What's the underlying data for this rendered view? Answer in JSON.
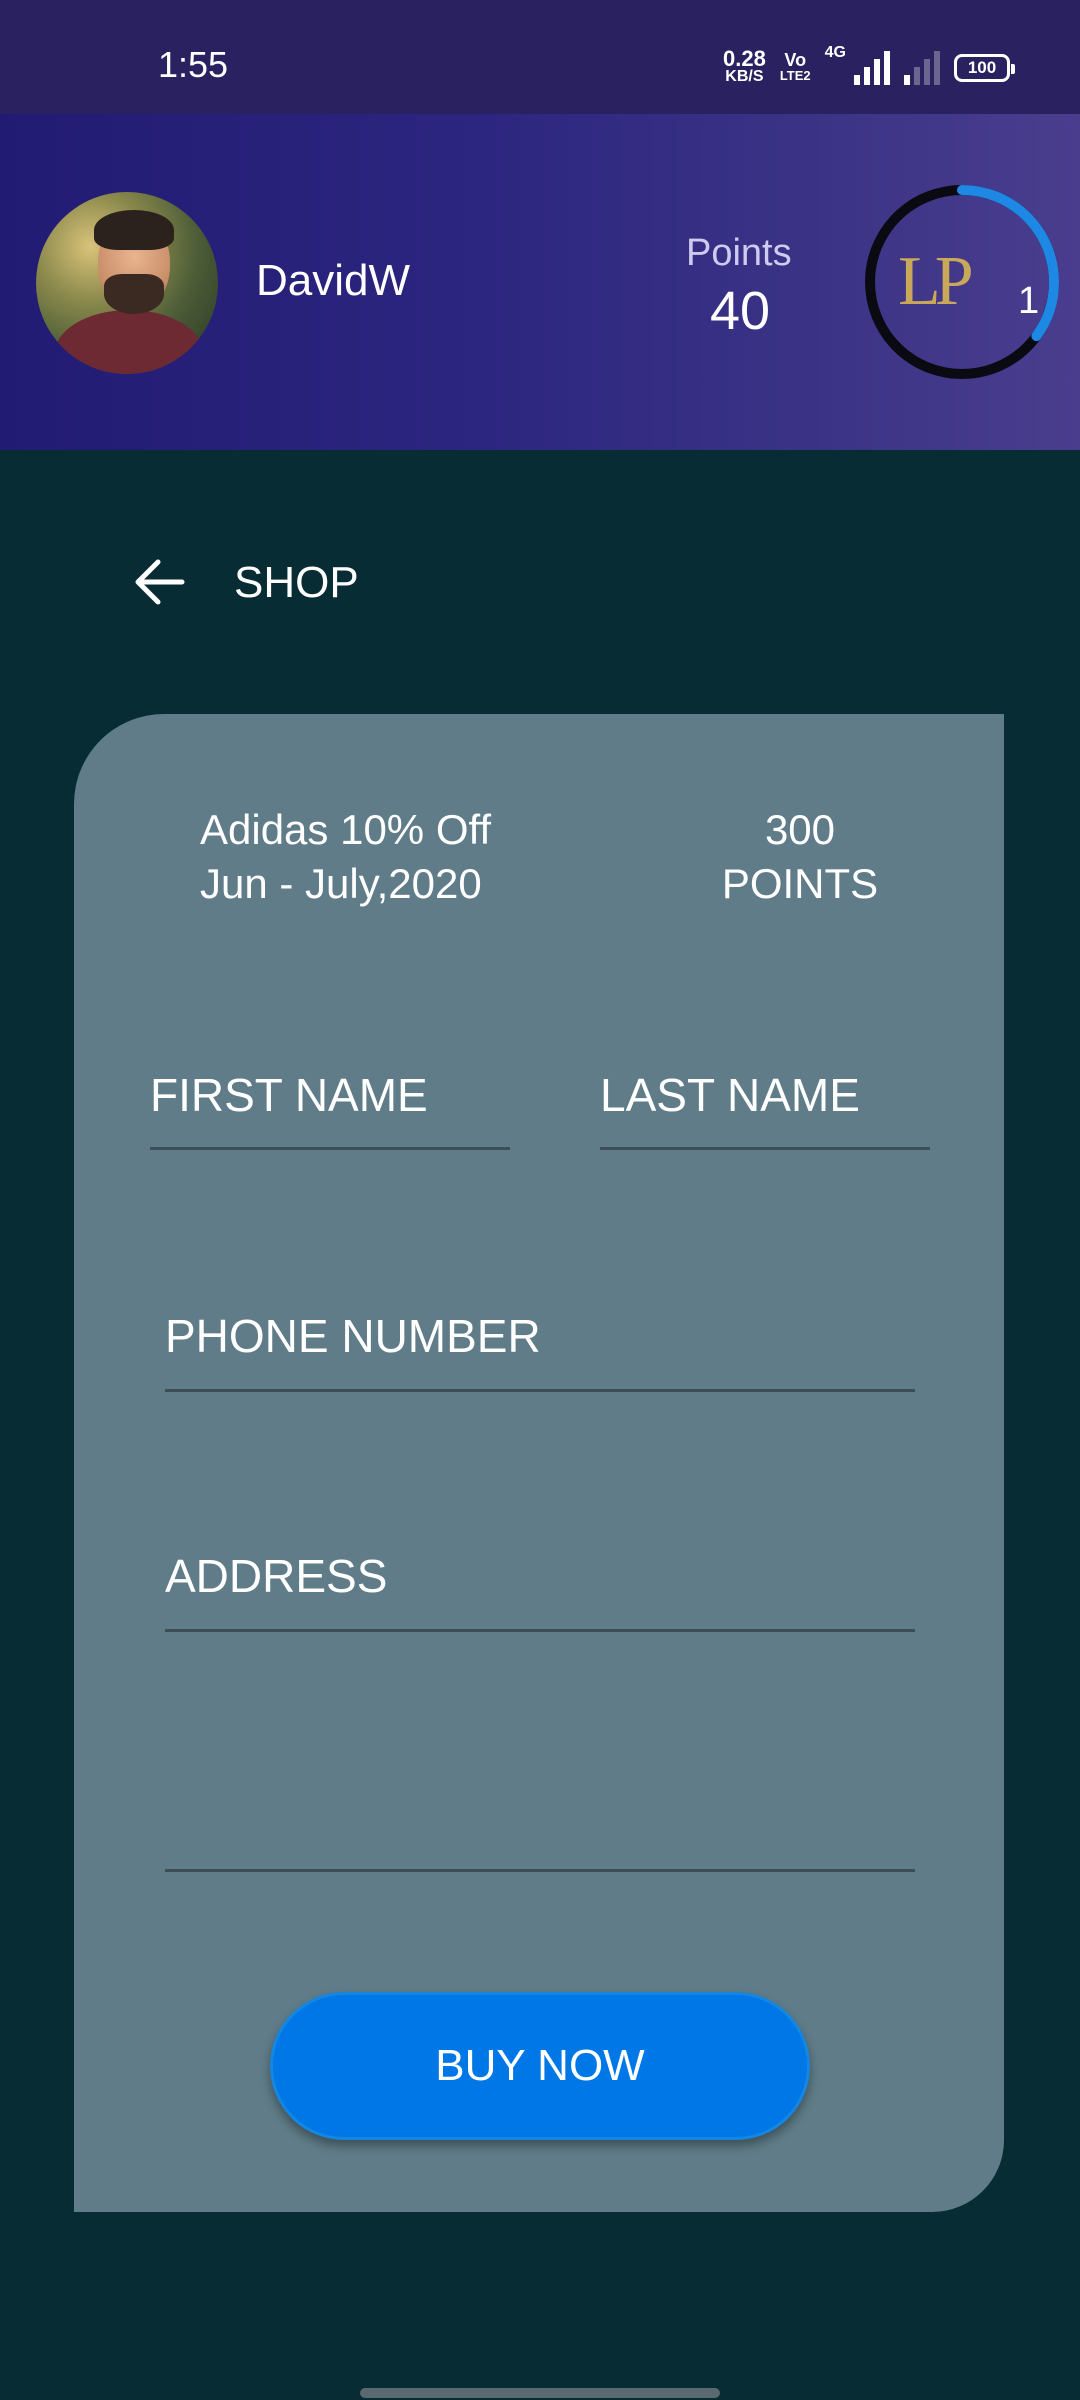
{
  "status_bar": {
    "time": "1:55",
    "net_speed_value": "0.28",
    "net_speed_unit": "KB/S",
    "volte_top": "Vo",
    "volte_bottom": "LTE2",
    "network_type": "4G",
    "battery": "100"
  },
  "header": {
    "username": "DavidW",
    "points_label": "Points",
    "points_value": "40",
    "level_badge": "LP",
    "level_number": "1",
    "level_progress_fraction": 0.35,
    "colors": {
      "ring_track": "#0a0a12",
      "ring_progress": "#1e88e5"
    }
  },
  "nav": {
    "title": "SHOP",
    "back_icon": "arrow-left-icon"
  },
  "offer": {
    "name": "Adidas 10% Off",
    "dates": "Jun - July,2020",
    "points": "300",
    "points_unit": "POINTS"
  },
  "form": {
    "first_name_placeholder": "FIRST NAME",
    "last_name_placeholder": "LAST NAME",
    "phone_placeholder": "PHONE NUMBER",
    "address_placeholder": "ADDRESS",
    "address_line2_placeholder": ""
  },
  "buy_button": {
    "label": "BUY NOW"
  },
  "colors": {
    "background": "#082c33",
    "card": "#5f7c88",
    "button": "#0077e6",
    "header_start": "#221b73",
    "header_end": "#4a3d8e"
  }
}
